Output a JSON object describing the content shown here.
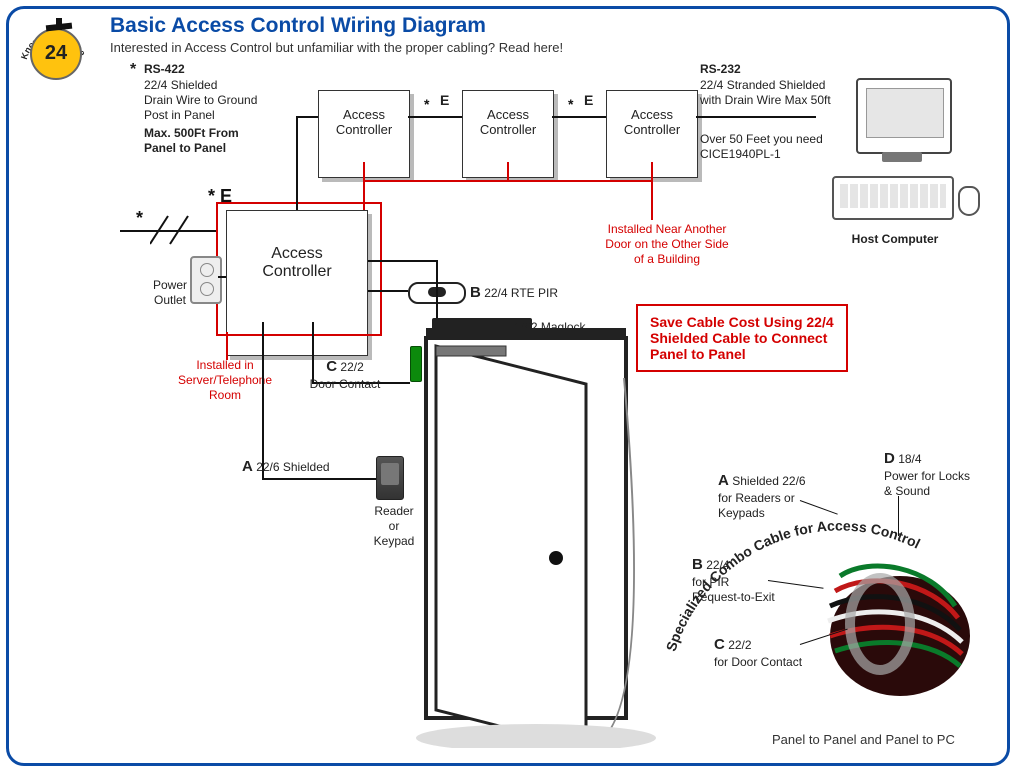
{
  "header": {
    "title": "Basic Access Control Wiring Diagram",
    "subtitle": "Interested in Access Control but unfamiliar with the proper cabling? Read here!",
    "badge_number": "24",
    "badge_ring": "Knowledge Base"
  },
  "rs422": {
    "star": "*",
    "heading": "RS-422",
    "lines": "22/4 Shielded\nDrain Wire to Ground\nPost in Panel",
    "max": "Max. 500Ft From\nPanel to Panel"
  },
  "rs232": {
    "heading": "RS-232",
    "lines": "22/4 Stranded Shielded\nwith Drain Wire Max 50ft",
    "note": "Over 50 Feet you need\nCICE1940PL-1"
  },
  "controllers": {
    "small_label": "Access\nController",
    "big_label": "Access\nController",
    "link_E": "E",
    "link_star": "*"
  },
  "host": {
    "label": "Host Computer"
  },
  "big_ctrl_tag": {
    "star_E": "* E"
  },
  "power": {
    "label": "Power\nOutlet"
  },
  "install_server": "Installed in\nServer/Telephone\nRoom",
  "install_other": "Installed Near Another\nDoor on the Other Side\nof a Building",
  "devices": {
    "A": {
      "letter": "A",
      "text": "22/6 Shielded",
      "caption": "Reader\nor\nKeypad"
    },
    "B": {
      "letter": "B",
      "text": "22/4 RTE PIR"
    },
    "C": {
      "letter": "C",
      "text": "22/2\nDoor Contact"
    },
    "D": {
      "letter": "D",
      "text": "18/2 Maglock"
    }
  },
  "tip": "Save Cable Cost Using 22/4\nShielded Cable to Connect\nPanel to Panel",
  "combo": {
    "arc_text": "Specialized Combo Cable for Access Control",
    "A": {
      "letter": "A",
      "text": "Shielded 22/6\nfor Readers or\nKeypads"
    },
    "B": {
      "letter": "B",
      "text": "22/4\nfor PIR\nRequest-to-Exit"
    },
    "C": {
      "letter": "C",
      "text": "22/2\nfor Door Contact"
    },
    "D": {
      "letter": "D",
      "text": "18/4\nPower for Locks\n& Sound"
    },
    "footer": "Panel to Panel and Panel to PC"
  }
}
